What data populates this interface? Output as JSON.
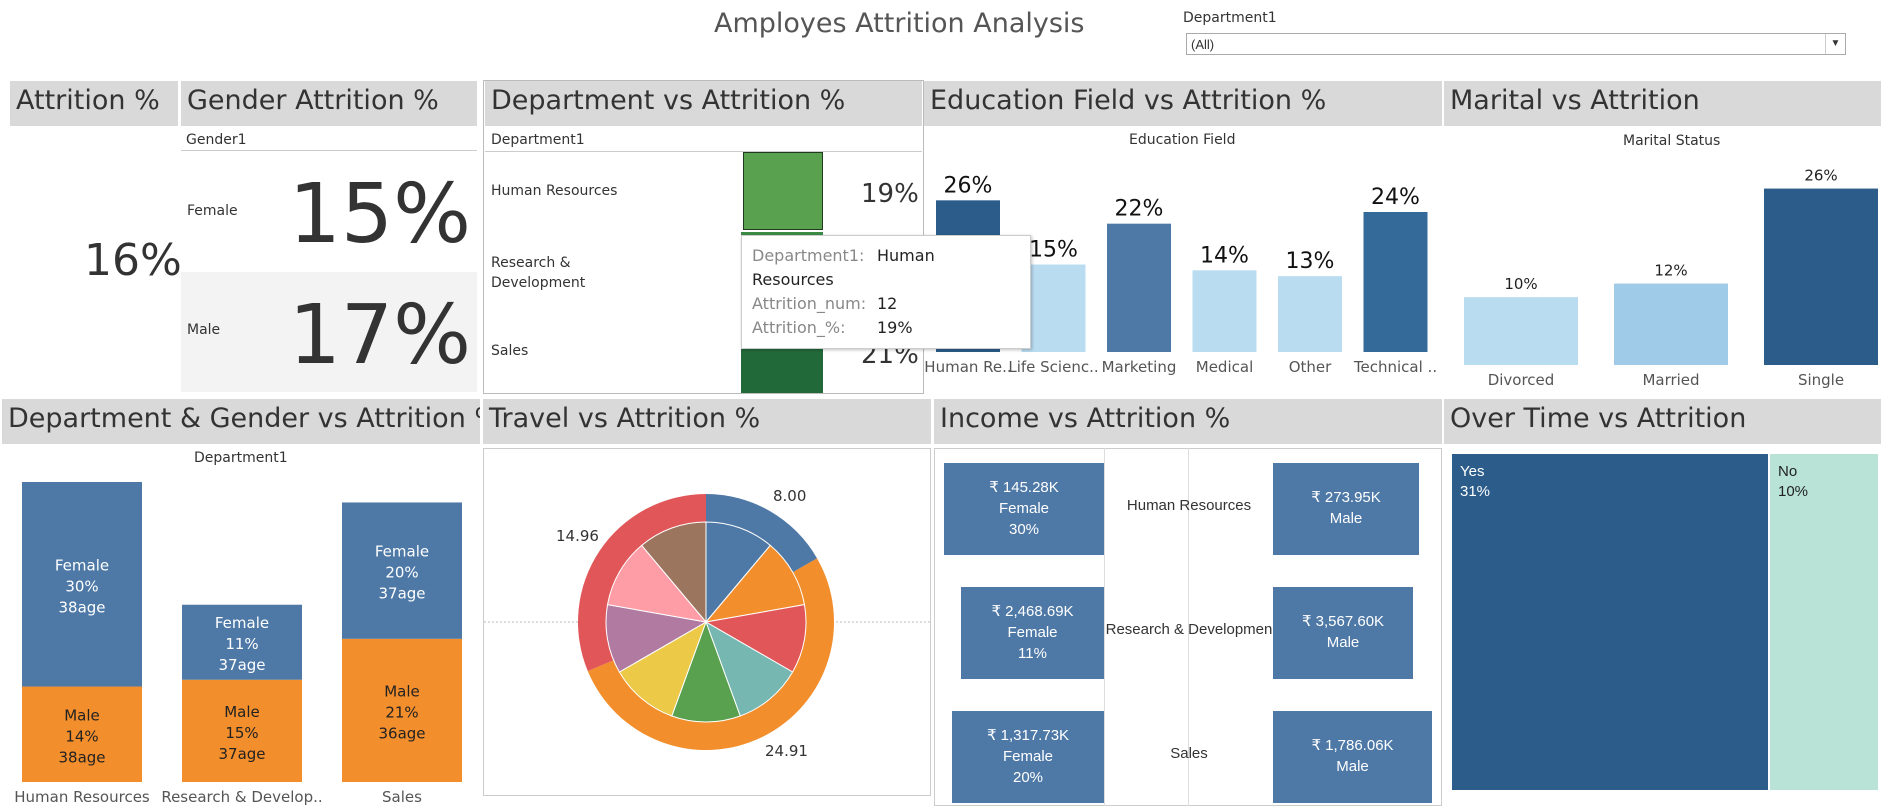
{
  "title": "Amployes Attrition Analysis",
  "filter": {
    "label": "Department1",
    "value": "(All)"
  },
  "headers": {
    "attrition": "Attrition %",
    "gender": "Gender Attrition %",
    "department": "Department vs Attrition %",
    "education": "Education Field vs Attrition %",
    "marital": "Marital vs Attrition",
    "dept_gender": "Department & Gender vs Attrition %",
    "travel": "Travel vs Attrition %",
    "income": "Income vs Attrition %",
    "overtime": "Over Time vs Attrition"
  },
  "attrition_total": "16%",
  "gender_panel": {
    "column": "Gender1",
    "rows": [
      {
        "label": "Female",
        "value": "15%"
      },
      {
        "label": "Male",
        "value": "17%"
      }
    ]
  },
  "department_panel": {
    "column": "Department1",
    "rows": [
      {
        "label": "Human Resources",
        "value": "19%"
      },
      {
        "label": "Research & Development",
        "value": ""
      },
      {
        "label": "Sales",
        "value": "21%"
      }
    ]
  },
  "tooltip": {
    "rows": [
      {
        "key": "Department1:",
        "value": "Human Resources"
      },
      {
        "key": "Attrition_num:",
        "value": "12"
      },
      {
        "key": "Attrition_%:",
        "value": "19%"
      }
    ]
  },
  "colors": {
    "dark_blue": "#2b5c8a",
    "mid_blue": "#4e79a7",
    "light_blue": "#a0cbe8",
    "orange": "#f28e2b",
    "mint": "#b8e3d6",
    "green": "#59a14f",
    "dark_green": "#22693a"
  },
  "chart_data": [
    {
      "type": "bar",
      "title": "Education Field",
      "categories": [
        "Human Re..",
        "Life Scienc..",
        "Marketing",
        "Medical",
        "Other",
        "Technical .."
      ],
      "values": [
        26,
        15,
        22,
        14,
        13,
        24
      ],
      "labels": [
        "26%",
        "15%",
        "22%",
        "14%",
        "13%",
        "24%"
      ],
      "colors": [
        "#2b5c8a",
        "#b9dcf0",
        "#4e79a7",
        "#b9dcf0",
        "#b9dcf0",
        "#336a99"
      ],
      "ylim": [
        0,
        30
      ]
    },
    {
      "type": "bar",
      "title": "Marital Status",
      "categories": [
        "Divorced",
        "Married",
        "Single"
      ],
      "values": [
        10,
        12,
        26
      ],
      "labels": [
        "10%",
        "12%",
        "26%"
      ],
      "colors": [
        "#b9dcf0",
        "#a0cbe8",
        "#2b5c8a"
      ],
      "ylim": [
        0,
        28
      ]
    },
    {
      "type": "bar",
      "title": "Department1",
      "categories": [
        "Human Resources",
        "Research & Develop..",
        "Sales"
      ],
      "series": [
        {
          "name": "Male",
          "pct": [
            14,
            15,
            21
          ],
          "labels": [
            [
              "Male",
              "14%",
              "38age"
            ],
            [
              "Male",
              "15%",
              "37age"
            ],
            [
              "Male",
              "21%",
              "36age"
            ]
          ],
          "color": "#f28e2b"
        },
        {
          "name": "Female",
          "pct": [
            30,
            11,
            20
          ],
          "labels": [
            [
              "Female",
              "30%",
              "38age"
            ],
            [
              "Female",
              "11%",
              "37age"
            ],
            [
              "Female",
              "20%",
              "37age"
            ]
          ],
          "color": "#4e79a7"
        }
      ],
      "stack_totals": [
        44,
        26,
        41
      ]
    },
    {
      "type": "pie",
      "labels": [
        "8.00",
        "24.91",
        "14.96"
      ],
      "outer_values": [
        8.0,
        24.91,
        14.96
      ],
      "outer_colors": [
        "#4e79a7",
        "#f28e2b",
        "#e15759"
      ],
      "inner_colors": [
        "#4e79a7",
        "#f28e2b",
        "#e15759",
        "#76b7b2",
        "#59a14f",
        "#edc948",
        "#b07aa1",
        "#ff9da7",
        "#9c755f"
      ]
    },
    {
      "type": "table",
      "rows": [
        {
          "department": "Human Resources",
          "female": [
            "₹ 145.28K",
            "Female",
            "30%"
          ],
          "male": [
            "₹ 273.95K",
            "Male"
          ]
        },
        {
          "department": "Research & Developmen",
          "female": [
            "₹ 2,468.69K",
            "Female",
            "11%"
          ],
          "male": [
            "₹ 3,567.60K",
            "Male"
          ]
        },
        {
          "department": "Sales",
          "female": [
            "₹ 1,317.73K",
            "Female",
            "20%"
          ],
          "male": [
            "₹ 1,786.06K",
            "Male"
          ]
        }
      ]
    },
    {
      "type": "heatmap",
      "cells": [
        {
          "label": "Yes",
          "value": "31%",
          "pct": 31,
          "color": "#2b5c8a"
        },
        {
          "label": "No",
          "value": "10%",
          "pct": 10,
          "color": "#b8e3d6"
        }
      ]
    }
  ]
}
